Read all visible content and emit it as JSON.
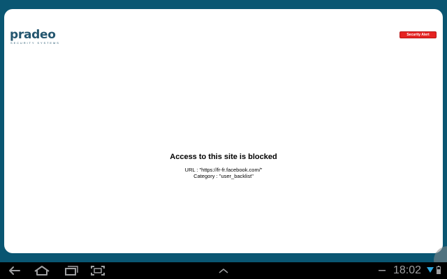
{
  "brand": {
    "name": "pradeo",
    "tagline": "SECURITY SYSTEMS"
  },
  "alert_button": {
    "label": "Security Alert"
  },
  "block_message": {
    "title": "Access to this site is blocked",
    "url_line": "URL : \"https://fr-fr.facebook.com/\"",
    "category_line": "Category : \"user_backlist\""
  },
  "system_bar": {
    "time": "18:02",
    "icons": [
      "back-icon",
      "home-icon",
      "recent-apps-icon",
      "screenshot-icon",
      "menu-up-icon",
      "minus-icon",
      "wifi-icon",
      "battery-icon"
    ]
  },
  "colors": {
    "frame": "#0a5672",
    "brand": "#24566f",
    "alert": "#e52322",
    "navbar": "#000000",
    "nav_icon": "#9fa0a2"
  }
}
